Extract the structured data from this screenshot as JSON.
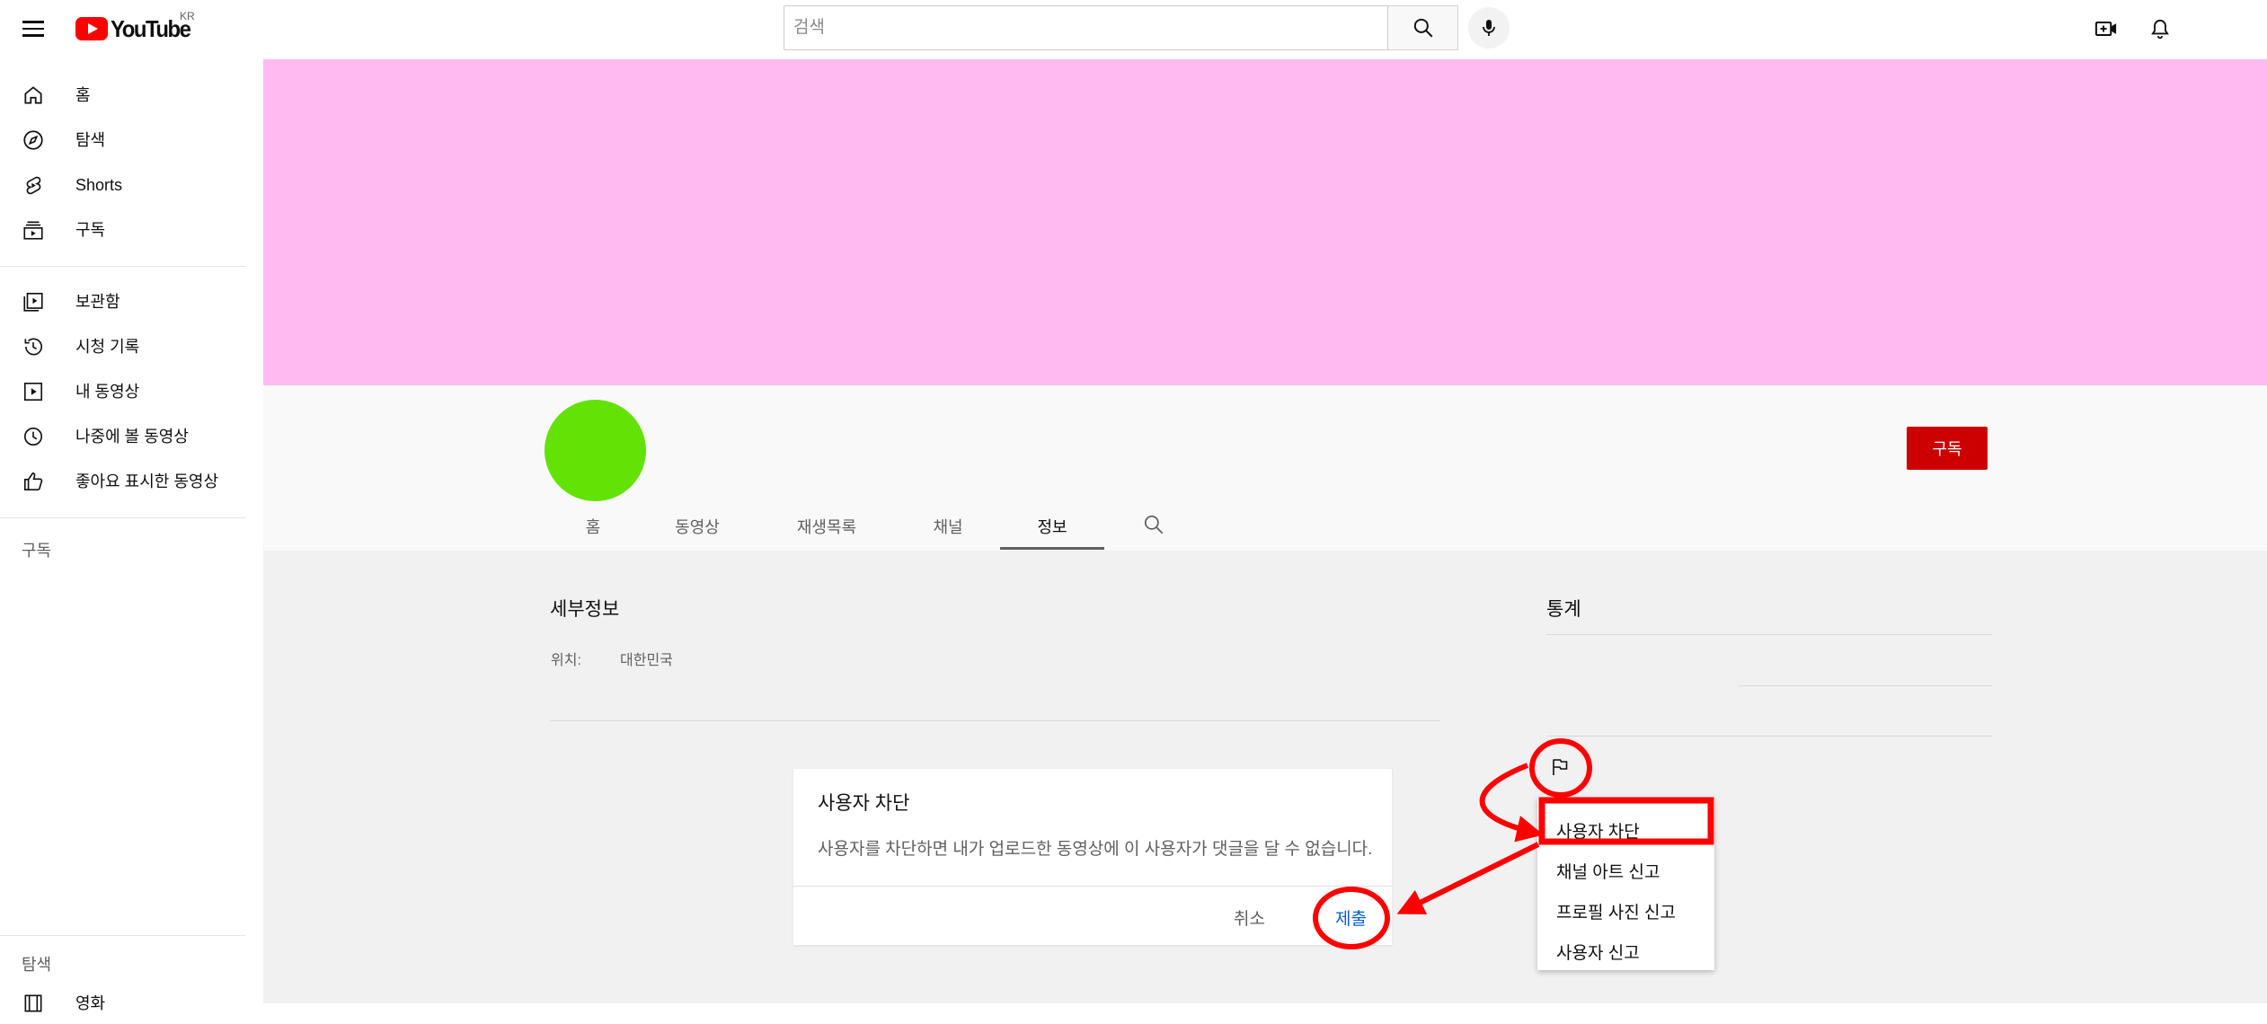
{
  "header": {
    "logo_text": "YouTube",
    "region": "KR",
    "search_placeholder": "검색"
  },
  "sidebar": {
    "primary": [
      {
        "label": "홈",
        "icon": "home-icon"
      },
      {
        "label": "탐색",
        "icon": "compass-icon"
      },
      {
        "label": "Shorts",
        "icon": "shorts-icon"
      },
      {
        "label": "구독",
        "icon": "subscriptions-icon"
      }
    ],
    "library": [
      {
        "label": "보관함",
        "icon": "library-icon"
      },
      {
        "label": "시청 기록",
        "icon": "history-icon"
      },
      {
        "label": "내 동영상",
        "icon": "my-videos-icon"
      },
      {
        "label": "나중에 볼 동영상",
        "icon": "watch-later-icon"
      },
      {
        "label": "좋아요 표시한 동영상",
        "icon": "like-icon"
      }
    ],
    "subscriptions_heading": "구독",
    "explore_heading": "탐색",
    "explore_first_item": "영화"
  },
  "channel": {
    "subscribe_label": "구독",
    "tabs": [
      {
        "label": "홈"
      },
      {
        "label": "동영상"
      },
      {
        "label": "재생목록"
      },
      {
        "label": "채널"
      },
      {
        "label": "정보"
      }
    ],
    "active_tab": "정보"
  },
  "about": {
    "details_title": "세부정보",
    "location_label": "위치:",
    "location_value": "대한민국",
    "stats_title": "통계"
  },
  "dialog": {
    "title": "사용자 차단",
    "body": "사용자를 차단하면 내가 업로드한 동영상에 이 사용자가 댓글을 달 수 없습니다.",
    "cancel_label": "취소",
    "submit_label": "제출"
  },
  "report_menu": {
    "items": [
      "사용자 차단",
      "채널 아트 신고",
      "프로필 사진 신고",
      "사용자 신고"
    ]
  },
  "colors": {
    "banner": "#ffbbf1",
    "avatar": "#63e305",
    "subscribe": "#cc0000",
    "annotation": "#ff0000",
    "link": "#065fd4"
  }
}
